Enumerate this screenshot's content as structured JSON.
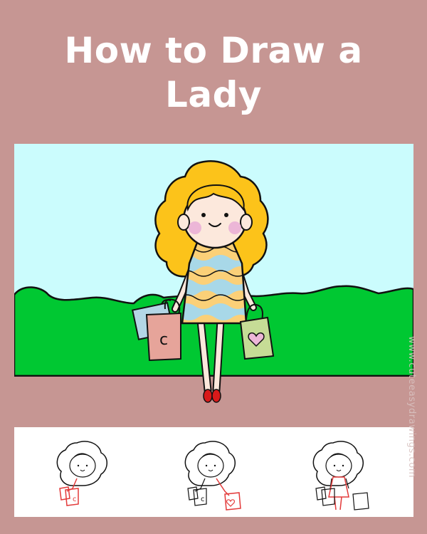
{
  "title": {
    "line1": "How to Draw a",
    "line2": "Lady"
  },
  "watermark": "www.cuteeasydrawings.com",
  "colors": {
    "background": "#c69693",
    "sky": "#cbfcfd",
    "grass": "#00c832",
    "hair": "#fcc31a",
    "skin": "#fce8dc",
    "cheeks": "#ecb6d7",
    "dress_yellow": "#fbd078",
    "dress_blue": "#a8d8e8",
    "bag_left": "#e6a49a",
    "bag_right": "#c6dc96",
    "shoes": "#d81a1a",
    "step_highlight": "#e33a3a"
  },
  "main_illustration": {
    "subject": "lady-with-shopping-bags",
    "bag_left_letter": "c",
    "bag_right_icon": "heart-icon"
  },
  "steps": [
    {
      "name": "step-1"
    },
    {
      "name": "step-2"
    },
    {
      "name": "step-3"
    }
  ]
}
